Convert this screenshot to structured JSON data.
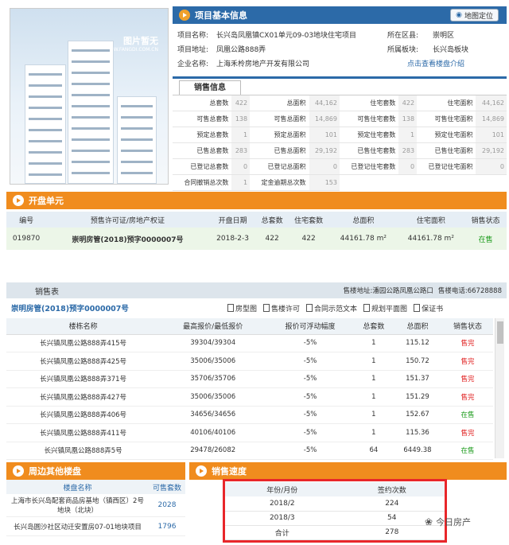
{
  "project_info": {
    "title": "项目基本信息",
    "map_button": "地图定位",
    "photo_placeholder": "图片暂无",
    "watermark_url": "WWW.FANGDI.COM.CN",
    "fields": {
      "name_label": "项目名称:",
      "name_value": "长兴岛凤凰镇CX01单元09-03地块住宅项目",
      "district_label": "所在区县:",
      "district_value": "崇明区",
      "address_label": "项目地址:",
      "address_value": "凤凰公路888弄",
      "block_label": "所属板块:",
      "block_value": "长兴岛板块",
      "company_label": "企业名称:",
      "company_value": "上海禾柃房地产开发有限公司",
      "intro_link": "点击查看楼盘介绍"
    }
  },
  "sales_info": {
    "tab": "销售信息",
    "rows": [
      [
        {
          "l": "总套数",
          "v": "422"
        },
        {
          "l": "总面积",
          "v": "44,162"
        },
        {
          "l": "住宅套数",
          "v": "422"
        },
        {
          "l": "住宅面积",
          "v": "44,162"
        }
      ],
      [
        {
          "l": "可售总套数",
          "v": "138"
        },
        {
          "l": "可售总面积",
          "v": "14,869"
        },
        {
          "l": "可售住宅套数",
          "v": "138"
        },
        {
          "l": "可售住宅面积",
          "v": "14,869"
        }
      ],
      [
        {
          "l": "预定总套数",
          "v": "1"
        },
        {
          "l": "预定总面积",
          "v": "101"
        },
        {
          "l": "预定住宅套数",
          "v": "1"
        },
        {
          "l": "预定住宅面积",
          "v": "101"
        }
      ],
      [
        {
          "l": "已售总套数",
          "v": "283"
        },
        {
          "l": "已售总面积",
          "v": "29,192"
        },
        {
          "l": "已售住宅套数",
          "v": "283"
        },
        {
          "l": "已售住宅面积",
          "v": "29,192"
        }
      ],
      [
        {
          "l": "已登记总套数",
          "v": "0"
        },
        {
          "l": "已登记总面积",
          "v": "0"
        },
        {
          "l": "已登记住宅套数",
          "v": "0"
        },
        {
          "l": "已登记住宅面积",
          "v": "0"
        }
      ],
      [
        {
          "l": "合同撤销总次数",
          "v": "1"
        },
        {
          "l": "定金逾期总次数",
          "v": "153"
        }
      ]
    ]
  },
  "opening": {
    "title": "开盘单元",
    "headers": [
      "编号",
      "预售许可证/房地产权证",
      "开盘日期",
      "总套数",
      "住宅套数",
      "总面积",
      "住宅面积",
      "销售状态"
    ],
    "row": [
      "019870",
      "崇明房管(2018)预字0000007号",
      "2018-2-3",
      "422",
      "422",
      "44161.78 m²",
      "44161.78 m²",
      "在售"
    ]
  },
  "sales_table": {
    "title": "销售表",
    "address": "售楼地址:潘园公路凤凰公路口",
    "phone": "售楼电话:66728888",
    "permit": "崇明房管(2018)预字0000007号",
    "links": [
      "房型图",
      "售楼许可",
      "合同示范文本",
      "规划平面图",
      "保证书"
    ],
    "headers": [
      "楼栋名称",
      "最高报价/最低报价",
      "报价可浮动幅度",
      "总套数",
      "总面积",
      "销售状态"
    ],
    "rows": [
      [
        "长兴镇凤凰公路888弄415号",
        "39304/39304",
        "-5%",
        "1",
        "115.12",
        "售完"
      ],
      [
        "长兴镇凤凰公路888弄425号",
        "35006/35006",
        "-5%",
        "1",
        "150.72",
        "售完"
      ],
      [
        "长兴镇凤凰公路888弄371号",
        "35706/35706",
        "-5%",
        "1",
        "151.37",
        "售完"
      ],
      [
        "长兴镇凤凰公路888弄427号",
        "35006/35006",
        "-5%",
        "1",
        "151.29",
        "售完"
      ],
      [
        "长兴镇凤凰公路888弄406号",
        "34656/34656",
        "-5%",
        "1",
        "152.67",
        "在售"
      ],
      [
        "长兴镇凤凰公路888弄411号",
        "40106/40106",
        "-5%",
        "1",
        "115.36",
        "售完"
      ],
      [
        "长兴镇凤凰公路888弄5号",
        "29478/26082",
        "-5%",
        "64",
        "6449.38",
        "在售"
      ]
    ]
  },
  "nearby": {
    "title": "周边其他楼盘",
    "headers": [
      "楼盘名称",
      "可售套数"
    ],
    "rows": [
      [
        "上海市长兴岛配套商品房基地（镇西区）2号地块（北块）",
        "2028"
      ],
      [
        "长兴岛圆沙社区动迁安置房07-01地块项目",
        "1796"
      ]
    ]
  },
  "speed": {
    "title": "销售速度",
    "headers": [
      "年份/月份",
      "签约次数"
    ],
    "rows": [
      [
        "2018/2",
        "224"
      ],
      [
        "2018/3",
        "54"
      ],
      [
        "合计",
        "278"
      ]
    ]
  },
  "brand": "今日房产",
  "colors": {
    "blue_header": "#2c6aa8",
    "orange_header": "#f08c1e",
    "sold": "#e02020",
    "on_sale": "#1a9a1a",
    "highlight_box": "#e8262a"
  }
}
